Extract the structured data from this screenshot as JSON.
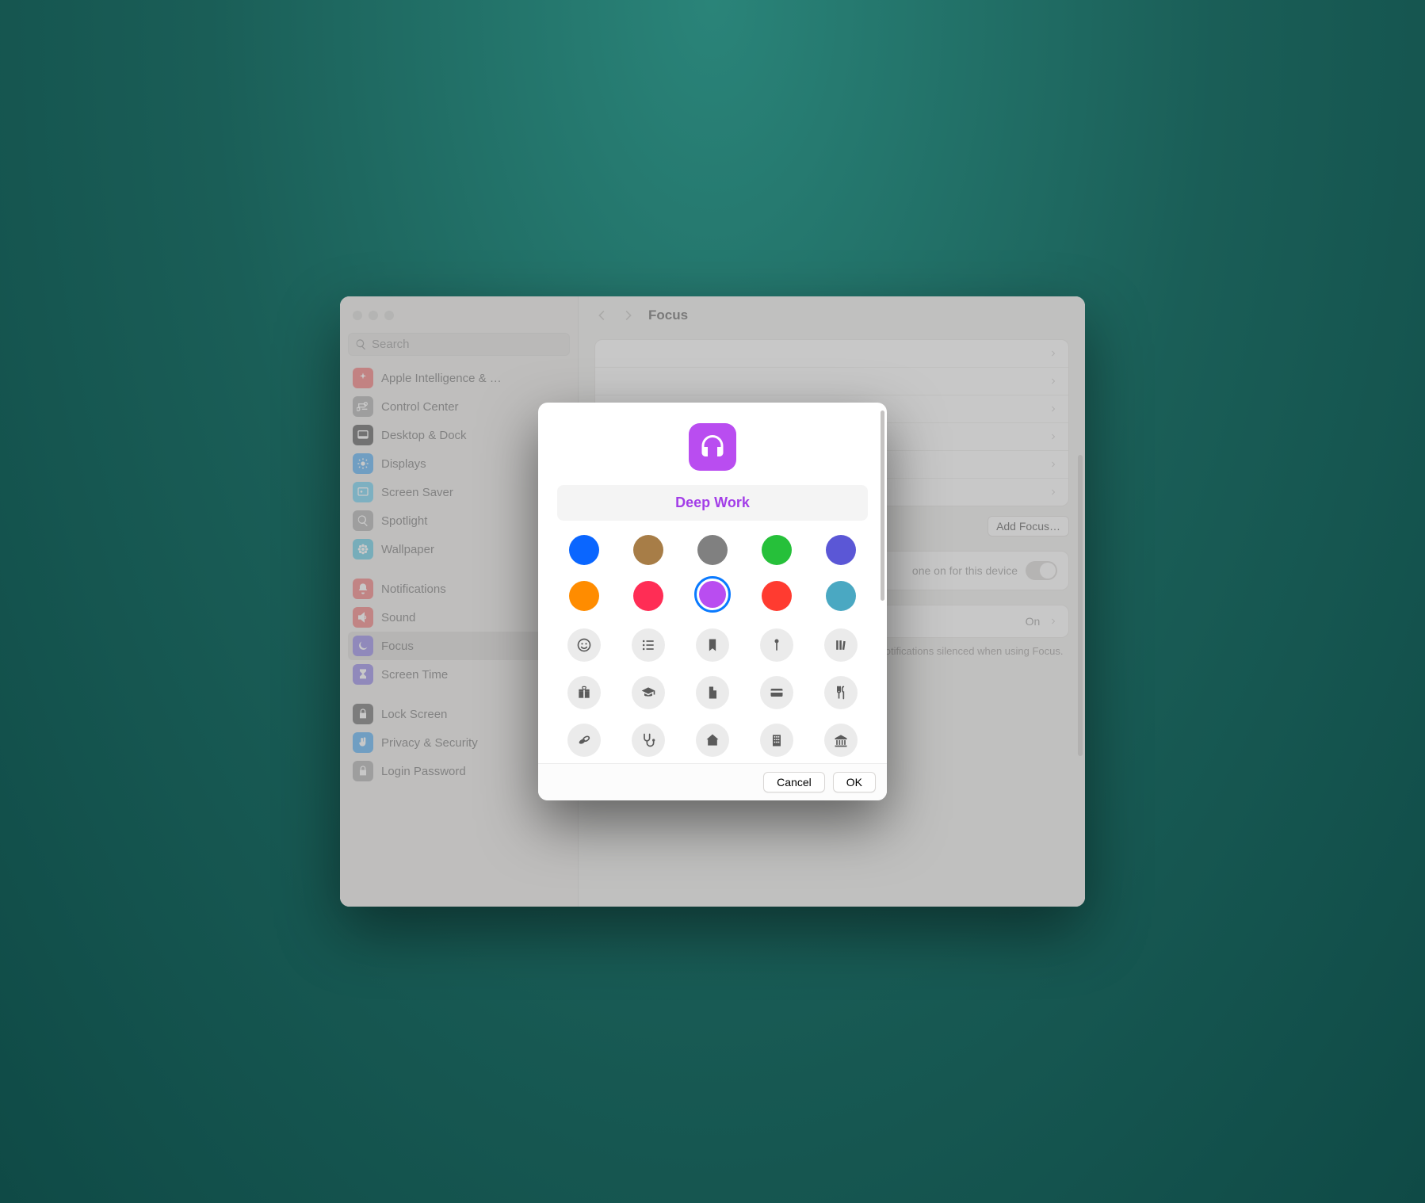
{
  "window": {
    "search_placeholder": "Search"
  },
  "sidebar": {
    "items": [
      {
        "label": "Apple Intelligence & …",
        "icon": "sparkle",
        "bg": "#f15a5a"
      },
      {
        "label": "Control Center",
        "icon": "switches",
        "bg": "#9b9b9b"
      },
      {
        "label": "Desktop & Dock",
        "icon": "dock",
        "bg": "#333333"
      },
      {
        "label": "Displays",
        "icon": "sun",
        "bg": "#2f9bf0"
      },
      {
        "label": "Screen Saver",
        "icon": "screensaver",
        "bg": "#4cc6ef"
      },
      {
        "label": "Spotlight",
        "icon": "magnify",
        "bg": "#9b9b9b"
      },
      {
        "label": "Wallpaper",
        "icon": "flower",
        "bg": "#3fbedd"
      }
    ],
    "group2": [
      {
        "label": "Notifications",
        "icon": "bell",
        "bg": "#ef5e5e"
      },
      {
        "label": "Sound",
        "icon": "speaker",
        "bg": "#ef5e5e"
      },
      {
        "label": "Focus",
        "icon": "moon",
        "bg": "#7a6adf",
        "selected": true
      },
      {
        "label": "Screen Time",
        "icon": "hourglass",
        "bg": "#7a6adf"
      }
    ],
    "group3": [
      {
        "label": "Lock Screen",
        "icon": "lock",
        "bg": "#4a4a4a"
      },
      {
        "label": "Privacy & Security",
        "icon": "hand",
        "bg": "#2f9bf0"
      },
      {
        "label": "Login Password",
        "icon": "lock",
        "bg": "#9b9b9b"
      }
    ]
  },
  "header": {
    "title": "Focus"
  },
  "content": {
    "rows": [
      "",
      "",
      "",
      "",
      "",
      ""
    ],
    "add_button": "Add Focus…",
    "share_row_tail": "one on for this device",
    "status_label": "On",
    "help": "When you give an app permission, it can share that you have notifications silenced when using Focus."
  },
  "modal": {
    "name": "Deep Work",
    "name_color": "#a33ee8",
    "header_bg": "#b94df0",
    "colors": [
      {
        "name": "blue",
        "hex": "#0a66ff"
      },
      {
        "name": "brown",
        "hex": "#a77d47"
      },
      {
        "name": "gray",
        "hex": "#808080"
      },
      {
        "name": "green",
        "hex": "#26c03a"
      },
      {
        "name": "indigo",
        "hex": "#5b57d6"
      },
      {
        "name": "orange",
        "hex": "#ff8c00"
      },
      {
        "name": "pink",
        "hex": "#ff2d55"
      },
      {
        "name": "purple",
        "hex": "#b94df0",
        "selected": true
      },
      {
        "name": "red",
        "hex": "#ff3b30"
      },
      {
        "name": "teal",
        "hex": "#4aa8c2"
      }
    ],
    "glyphs": [
      "smiley",
      "list",
      "bookmark",
      "pin",
      "books",
      "gift",
      "graduation",
      "document",
      "card",
      "cutlery",
      "pills",
      "stethoscope",
      "home",
      "building",
      "bank"
    ],
    "cancel": "Cancel",
    "ok": "OK"
  }
}
